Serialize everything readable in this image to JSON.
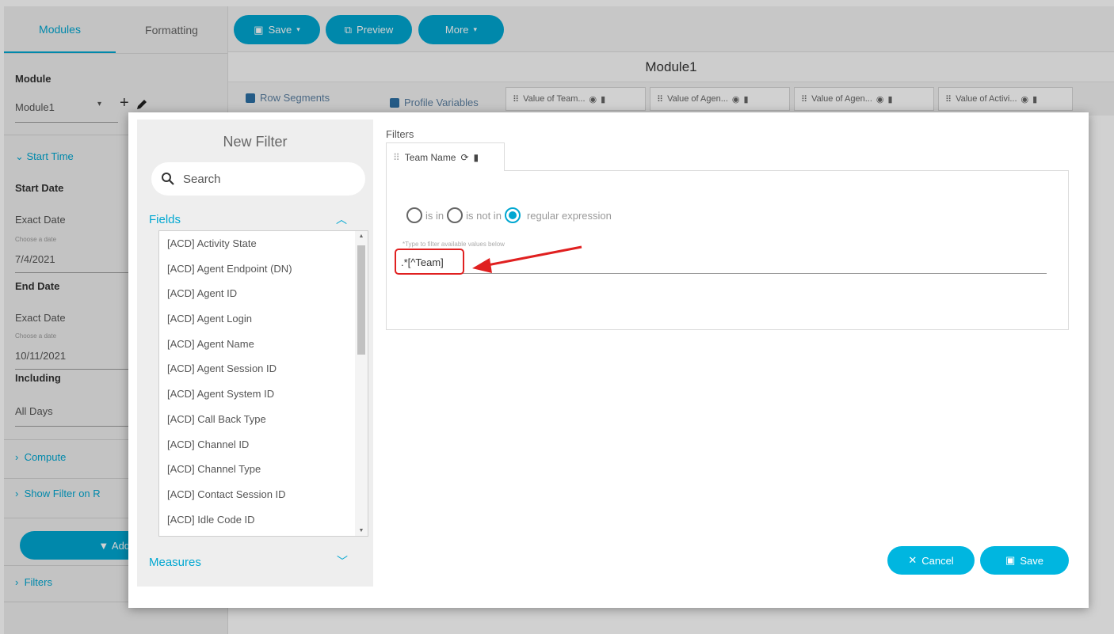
{
  "left_panel": {
    "tabs": [
      "Modules",
      "Formatting"
    ],
    "module_label": "Module",
    "module_value": "Module1",
    "start_time": "Start Time",
    "start_date_label": "Start Date",
    "start_date_type": "Exact Date",
    "choose_date_hint": "Choose a date",
    "start_date_value": "7/4/2021",
    "end_date_label": "End Date",
    "end_date_type": "Exact Date",
    "end_date_value": "10/11/2021",
    "including_label": "Including",
    "including_value": "All Days",
    "compute": "Compute",
    "show_filter": "Show Filter on R",
    "add_button": "Add F",
    "filters": "Filters"
  },
  "toolbar": {
    "save": "Save",
    "preview": "Preview",
    "more": "More"
  },
  "module_title": "Module1",
  "segments": {
    "row_segments": "Row Segments",
    "profile_variables": "Profile Variables",
    "variables": [
      "Value of Team...",
      "Value of Agen...",
      "Value of Agen...",
      "Value of Activi..."
    ]
  },
  "modal": {
    "title": "New Filter",
    "search_placeholder": "Search",
    "fields_header": "Fields",
    "fields": [
      "[ACD] Activity State",
      "[ACD] Agent Endpoint (DN)",
      "[ACD] Agent ID",
      "[ACD] Agent Login",
      "[ACD] Agent Name",
      "[ACD] Agent Session ID",
      "[ACD] Agent System ID",
      "[ACD] Call Back Type",
      "[ACD] Channel ID",
      "[ACD] Channel Type",
      "[ACD] Contact Session ID",
      "[ACD] Idle Code ID"
    ],
    "measures_header": "Measures",
    "filters_label": "Filters",
    "active_filter": "Team Name",
    "radio_is_in": "is in",
    "radio_is_not_in": "is not in",
    "radio_regex": "regular expression",
    "hint": "*Type to filter available values below",
    "regex_value": ".*[^Team]",
    "cancel": "Cancel",
    "save": "Save"
  },
  "colors": {
    "accent": "#00a7d1",
    "annotation": "#e02020"
  }
}
